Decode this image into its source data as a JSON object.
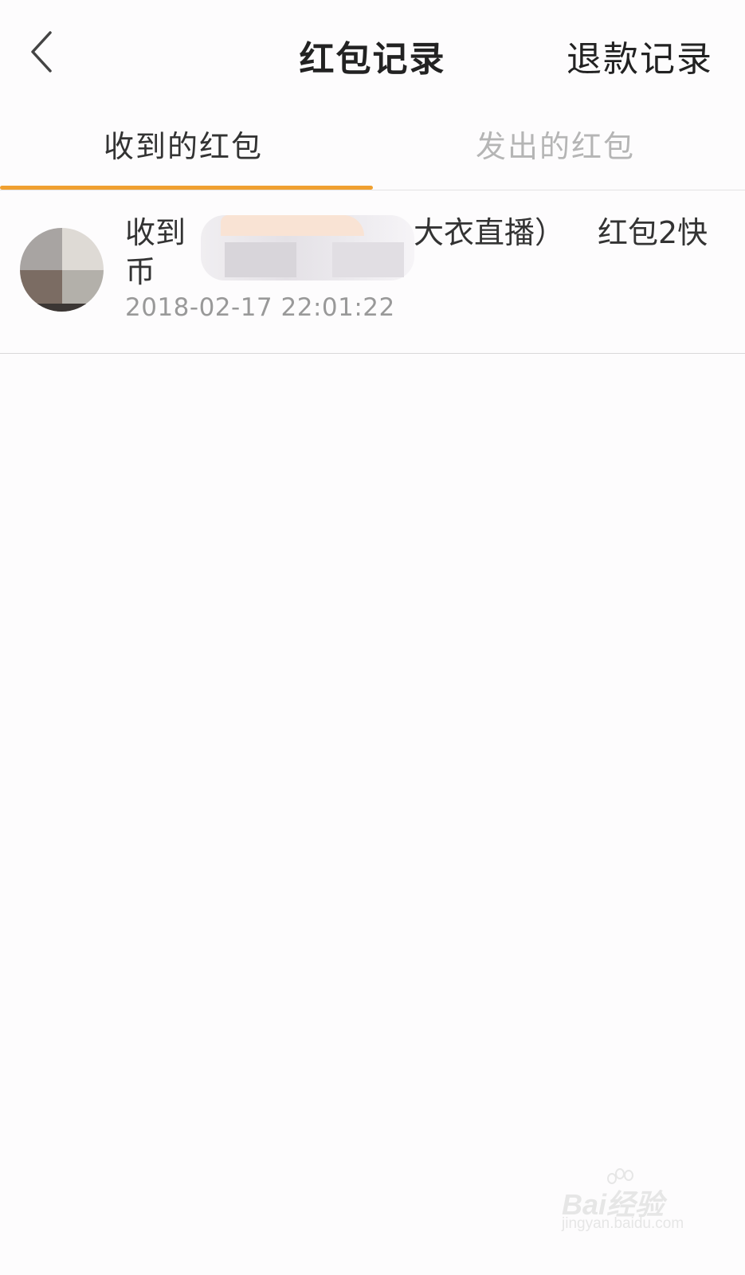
{
  "colors": {
    "accent": "#f0a030",
    "title_text": "#222222",
    "inactive_tab": "#b5b5b5",
    "timestamp": "#999999",
    "background": "#fdfcfd"
  },
  "header": {
    "back_icon": "chevron-left-icon",
    "title": "红包记录",
    "refund_link": "退款记录"
  },
  "tabs": [
    {
      "label": "收到的红包",
      "active": true
    },
    {
      "label": "发出的红包",
      "active": false
    }
  ],
  "records": [
    {
      "prefix": "收到",
      "middle": "大衣直播）",
      "amount": "红包2快",
      "continuation": "币",
      "time": "2018-02-17 22:01:22"
    }
  ],
  "watermark": {
    "logo": "Bai经验",
    "url": "jingyan.baidu.com"
  }
}
